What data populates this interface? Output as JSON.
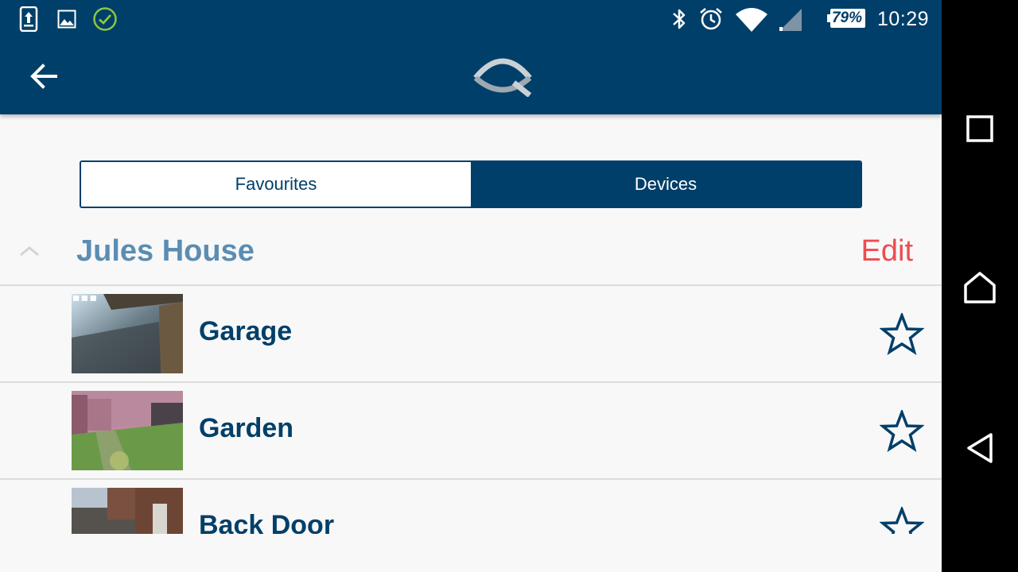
{
  "status_bar": {
    "left_icons": [
      "upload-phone-icon",
      "image-icon",
      "check-circle-icon"
    ],
    "right_icons": [
      "bluetooth-icon",
      "alarm-icon",
      "wifi-icon",
      "cell-signal-icon",
      "battery-icon"
    ],
    "battery_percent": "79%",
    "time": "10:29"
  },
  "app_bar": {
    "back_icon": "arrow-left-icon",
    "logo_icon": "q-logo-icon"
  },
  "tabs": [
    {
      "label": "Favourites",
      "active": false
    },
    {
      "label": "Devices",
      "active": true
    }
  ],
  "group": {
    "title": "Jules House",
    "edit_label": "Edit",
    "collapse_icon": "chevron-up-icon"
  },
  "devices": [
    {
      "name": "Garage",
      "thumbnail": "garage-camera-snapshot",
      "favourite": false
    },
    {
      "name": "Garden",
      "thumbnail": "garden-camera-snapshot",
      "favourite": false
    },
    {
      "name": "Back Door",
      "thumbnail": "back-door-camera-snapshot",
      "favourite": false
    }
  ],
  "nav_bar": {
    "icons": [
      "recent-apps-icon",
      "home-icon",
      "back-triangle-icon"
    ]
  },
  "colors": {
    "primary": "#003f69",
    "group_title": "#5b8db3",
    "edit": "#ef4b4f",
    "background": "#f8f8f8"
  }
}
